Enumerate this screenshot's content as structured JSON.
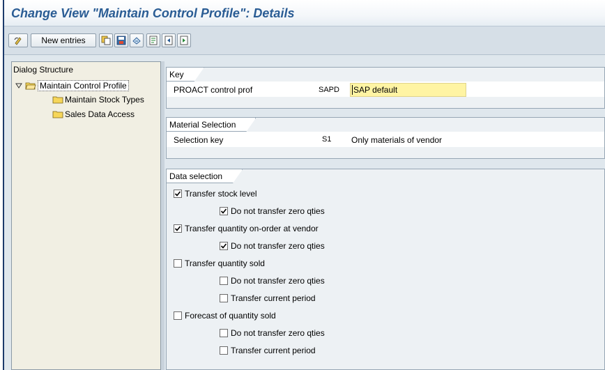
{
  "window": {
    "title": "Change View \"Maintain Control Profile\": Details"
  },
  "toolbar": {
    "new_entries_label": "New entries",
    "icons": [
      "change-display-icon",
      "copy-icon",
      "save-icon",
      "undo-icon",
      "first-entry-icon",
      "previous-entry-icon",
      "next-entry-icon"
    ]
  },
  "tree": {
    "header": "Dialog Structure",
    "items": [
      {
        "label": "Maintain Control Profile",
        "selected": true,
        "expanded": true
      },
      {
        "label": "Maintain Stock Types",
        "selected": false
      },
      {
        "label": "Sales Data Access",
        "selected": false
      }
    ]
  },
  "key_group": {
    "title": "Key",
    "field_label": "PROACT control prof",
    "code": "SAPD",
    "value": "SAP default"
  },
  "material_group": {
    "title": "Material Selection",
    "field_label": "Selection key",
    "code": "S1",
    "description": "Only materials of vendor"
  },
  "data_group": {
    "title": "Data selection",
    "options": [
      {
        "label": "Transfer stock level",
        "checked": true
      },
      {
        "label": "Do not transfer zero qties",
        "checked": true
      },
      {
        "label": "Transfer quantity on-order at vendor",
        "checked": true
      },
      {
        "label": "Do not transfer zero qties",
        "checked": true
      },
      {
        "label": "Transfer quantity sold",
        "checked": false
      },
      {
        "label": "Do not transfer zero qties",
        "checked": false
      },
      {
        "label": "Transfer current period",
        "checked": false
      },
      {
        "label": "Forecast of quantity sold",
        "checked": false
      },
      {
        "label": "Do not transfer zero qties",
        "checked": false
      },
      {
        "label": "Transfer current period",
        "checked": false
      }
    ]
  },
  "colors": {
    "title": "#2a5c94",
    "input_highlight": "#fff4a3",
    "tree_background": "#f1efe3"
  }
}
